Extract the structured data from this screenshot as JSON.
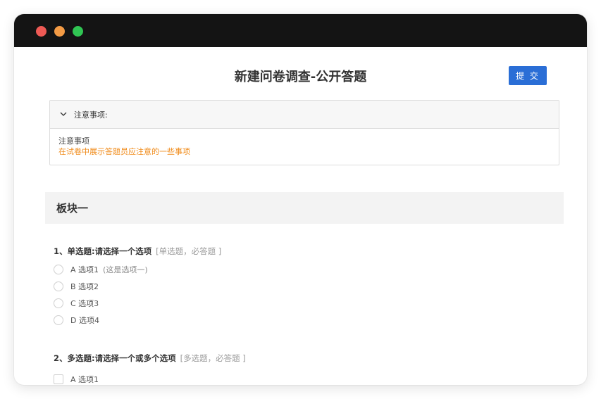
{
  "window": {
    "traffic_lights": [
      "close",
      "minimize",
      "maximize"
    ]
  },
  "page": {
    "title": "新建问卷调查-公开答题",
    "submit_label": "提 交"
  },
  "notice": {
    "header": "注意事项:",
    "line1": "注意事项",
    "line2": "在试卷中展示答题员应注意的一些事项"
  },
  "section": {
    "title": "板块一"
  },
  "questions": [
    {
      "number": "1、",
      "type_label": "单选题:",
      "prompt": "请选择一个选项",
      "meta": "[单选题，必答题 ]",
      "options": [
        {
          "label": "A 选项1",
          "note": "(这是选项一)"
        },
        {
          "label": "B 选项2",
          "note": ""
        },
        {
          "label": "C 选项3",
          "note": ""
        },
        {
          "label": "D 选项4",
          "note": ""
        }
      ]
    },
    {
      "number": "2、",
      "type_label": "多选题:",
      "prompt": "请选择一个或多个选项",
      "meta": "[多选题，必答题 ]",
      "options": [
        {
          "label": "A 选项1",
          "note": ""
        }
      ]
    }
  ],
  "colors": {
    "primary": "#2a6ed6",
    "notice_accent": "#f08c1c",
    "titlebar": "#141414"
  }
}
